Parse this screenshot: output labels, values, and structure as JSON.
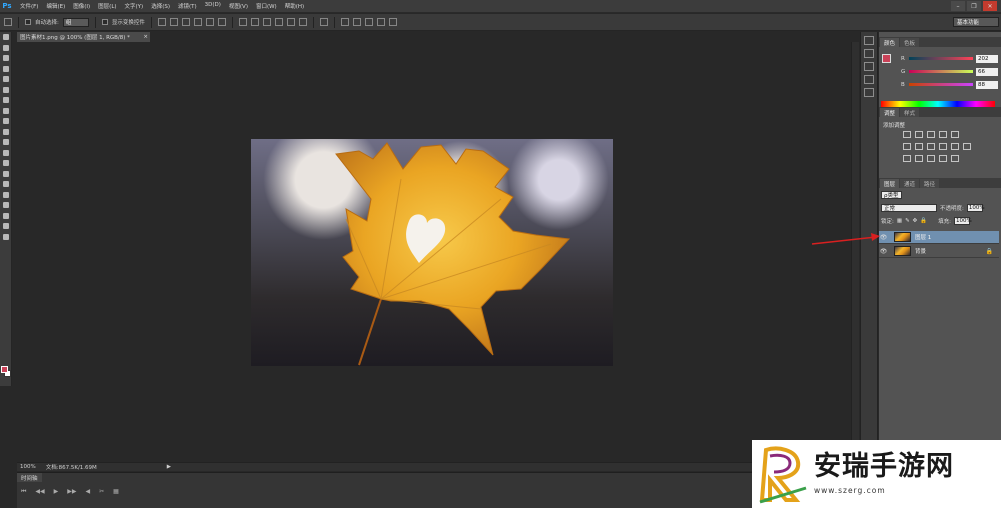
{
  "app": {
    "logo": "Ps",
    "menu": [
      "文件(F)",
      "编辑(E)",
      "图像(I)",
      "图层(L)",
      "文字(Y)",
      "选择(S)",
      "滤镜(T)",
      "3D(D)",
      "视图(V)",
      "窗口(W)",
      "帮助(H)"
    ],
    "window_controls": [
      "–",
      "❐",
      "✕"
    ]
  },
  "options": {
    "auto_select_label": "自动选择:",
    "auto_select_value": "组",
    "show_transform_label": "显示变换控件",
    "workspace": "基本功能"
  },
  "document": {
    "tab_title": "图片素材1.png @ 100% (图层 1, RGB/8) *",
    "tab_close": "×"
  },
  "status": {
    "zoom": "100%",
    "doc_size": "文档:867.5K/1.69M",
    "arrow": "▶"
  },
  "timeline": {
    "tab": "时间轴",
    "controls": [
      "⏮",
      "◀◀",
      "▶",
      "▶▶",
      "◀",
      "✂",
      "▦"
    ]
  },
  "color_panel": {
    "tabs": [
      "颜色",
      "色板"
    ],
    "channels": [
      {
        "label": "R",
        "value": "202"
      },
      {
        "label": "G",
        "value": "66"
      },
      {
        "label": "B",
        "value": "88"
      }
    ],
    "fg_color": "#ca4258"
  },
  "adjust_panel": {
    "tabs": [
      "调整",
      "样式"
    ],
    "title": "添加调整"
  },
  "layers_panel": {
    "tabs": [
      "图层",
      "通道",
      "路径"
    ],
    "kind": "ρ类型",
    "blend_mode": "正常",
    "opacity_label": "不透明度:",
    "opacity": "100%",
    "lock_label": "锁定:",
    "fill_label": "填充:",
    "fill": "100%",
    "layers": [
      {
        "name": "图层 1",
        "selected": true,
        "locked": false
      },
      {
        "name": "背景",
        "selected": false,
        "locked": true
      }
    ]
  },
  "watermark": {
    "title": "安瑞手游网",
    "url": "www.szerg.com"
  }
}
